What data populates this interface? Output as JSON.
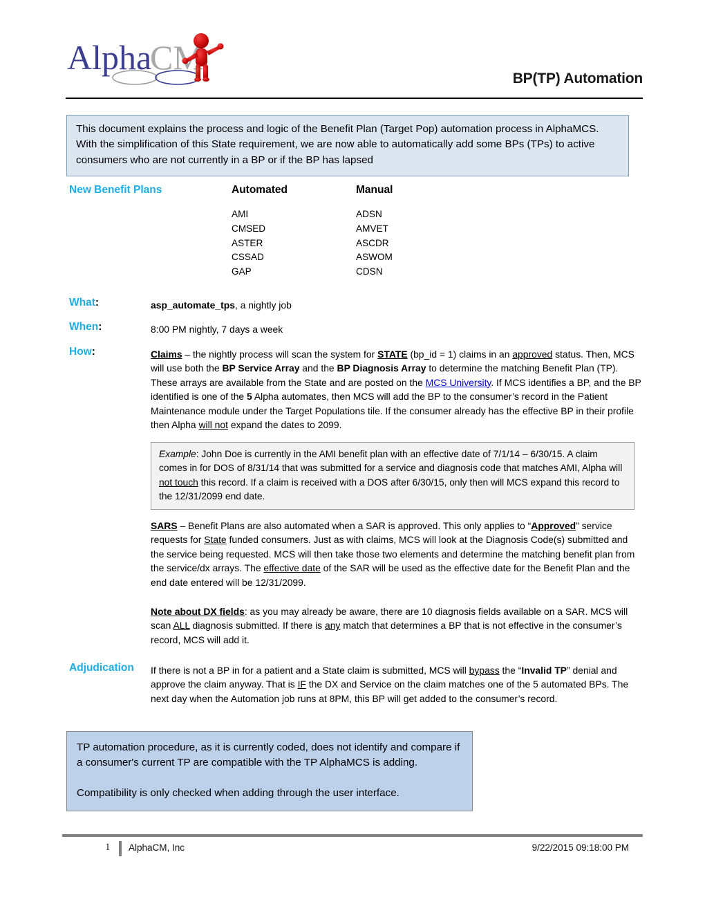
{
  "header": {
    "logo_alt": "AlphaCM",
    "logo_text_primary": "Alpha",
    "logo_text_secondary": "CM",
    "title": "BP(TP) Automation"
  },
  "intro": {
    "text": "This document explains the process and logic of the Benefit Plan (Target Pop) automation process in AlphaMCS.  With the simplification of this State requirement, we are now able to automatically add some BPs (TPs) to active consumers who are not currently in a BP or if the BP has lapsed"
  },
  "benefit_plans": {
    "section_title": "New Benefit Plans",
    "columns": [
      "Automated",
      "Manual"
    ],
    "automated": [
      "AMI",
      "CMSED",
      "ASTER",
      "CSSAD",
      "GAP"
    ],
    "manual": [
      "ADSN",
      "AMVET",
      "ASCDR",
      "ASWOM",
      "CDSN"
    ]
  },
  "definitions": {
    "what_label": "What",
    "what_colon": ":",
    "what_job_name": "asp_automate_tps",
    "what_job_rest": ", a nightly job",
    "when_label": "When",
    "when_colon": ":",
    "when_value": "8:00 PM nightly, 7 days a week",
    "how_label": "How",
    "how_colon": ":"
  },
  "how_claims": {
    "lead": "Claims",
    "t1": " – the nightly process will scan the system for ",
    "state": "STATE",
    "t2": " (bp_id = 1) claims in an ",
    "approved": "approved",
    "t3": " status. Then, MCS will use both the ",
    "service_array": "BP Service Array",
    "t4": " and the ",
    "diagnosis_array": "BP Diagnosis Array",
    "t5": " to determine the matching Benefit Plan (TP).  These arrays are available from the State and are posted on the ",
    "link_text": "MCS University",
    "t6": ".  If MCS identifies a BP, and the BP identified is one of the ",
    "count": "5",
    "t7": " Alpha automates, then MCS will add the BP to the consumer’s record in the Patient Maintenance module under the Target Populations tile.  If the consumer already has the effective BP in their profile then Alpha ",
    "will_not": "will not",
    "t8": " expand the dates to 2099."
  },
  "example": {
    "label": "Example",
    "t1": ":  John Doe is currently in the AMI benefit plan with an effective date of 7/1/14 – 6/30/15.  A claim comes in for DOS of 8/31/14 that was submitted for a service and diagnosis code that matches AMI, Alpha will ",
    "not_touch": "not touch",
    "t2": " this record.  If a claim is received with a DOS after 6/30/15, only then will MCS expand this record to the 12/31/2099 end date."
  },
  "sars": {
    "lead": "SARS",
    "t1": " – Benefit Plans are also automated when a SAR is approved.  This only applies to “",
    "approved": "Approved",
    "t2": "” service requests for ",
    "state": "State",
    "t3": " funded consumers.  Just as with claims, MCS will look at the Diagnosis Code(s) submitted and the service being requested.  MCS will then take those two elements and determine the matching benefit plan from the service/dx arrays.  The ",
    "effective_date": "effective date",
    "t4": " of the SAR will be used as the effective date for the Benefit Plan and the end date entered will be 12/31/2099."
  },
  "dx_note": {
    "lead": "Note about DX fields",
    "t1": ":  as you may already be aware, there are 10 diagnosis fields available on a SAR. MCS will scan ",
    "all": "ALL",
    "t2": " diagnosis submitted.  If there is ",
    "any": "any",
    "t3": " match that determines a BP that is not effective in the consumer’s record, MCS will add it."
  },
  "adjudication": {
    "label": "Adjudication",
    "t1": "If there is not a BP in for a patient and a State claim is submitted, MCS will ",
    "bypass": "bypass",
    "t2": " the “",
    "invalid_tp": "Invalid TP",
    "t3": "” denial and approve the claim anyway.  That is ",
    "if": "IF",
    "t4": " the DX and Service on the claim matches one of the 5 automated BPs.  The next day when the Automation job runs at 8PM, this BP will get added to the consumer’s record."
  },
  "note_box": {
    "paragraph1": "TP automation procedure, as it is currently coded, does not identify and compare if a consumer's current TP are compatible with the TP AlphaMCS is adding.",
    "paragraph2": "Compatibility is only checked when adding through the user interface."
  },
  "footer": {
    "page_number": "1",
    "company": "AlphaCM, Inc",
    "timestamp": "9/22/2015 09:18:00 PM"
  },
  "colors": {
    "accent_cyan": "#1cade4",
    "intro_box_bg": "#dce6f1",
    "note_box_bg": "#bdd2ea",
    "example_box_bg": "#f2f2f2",
    "link": "#0000cc",
    "footer_rule": "#808080"
  }
}
